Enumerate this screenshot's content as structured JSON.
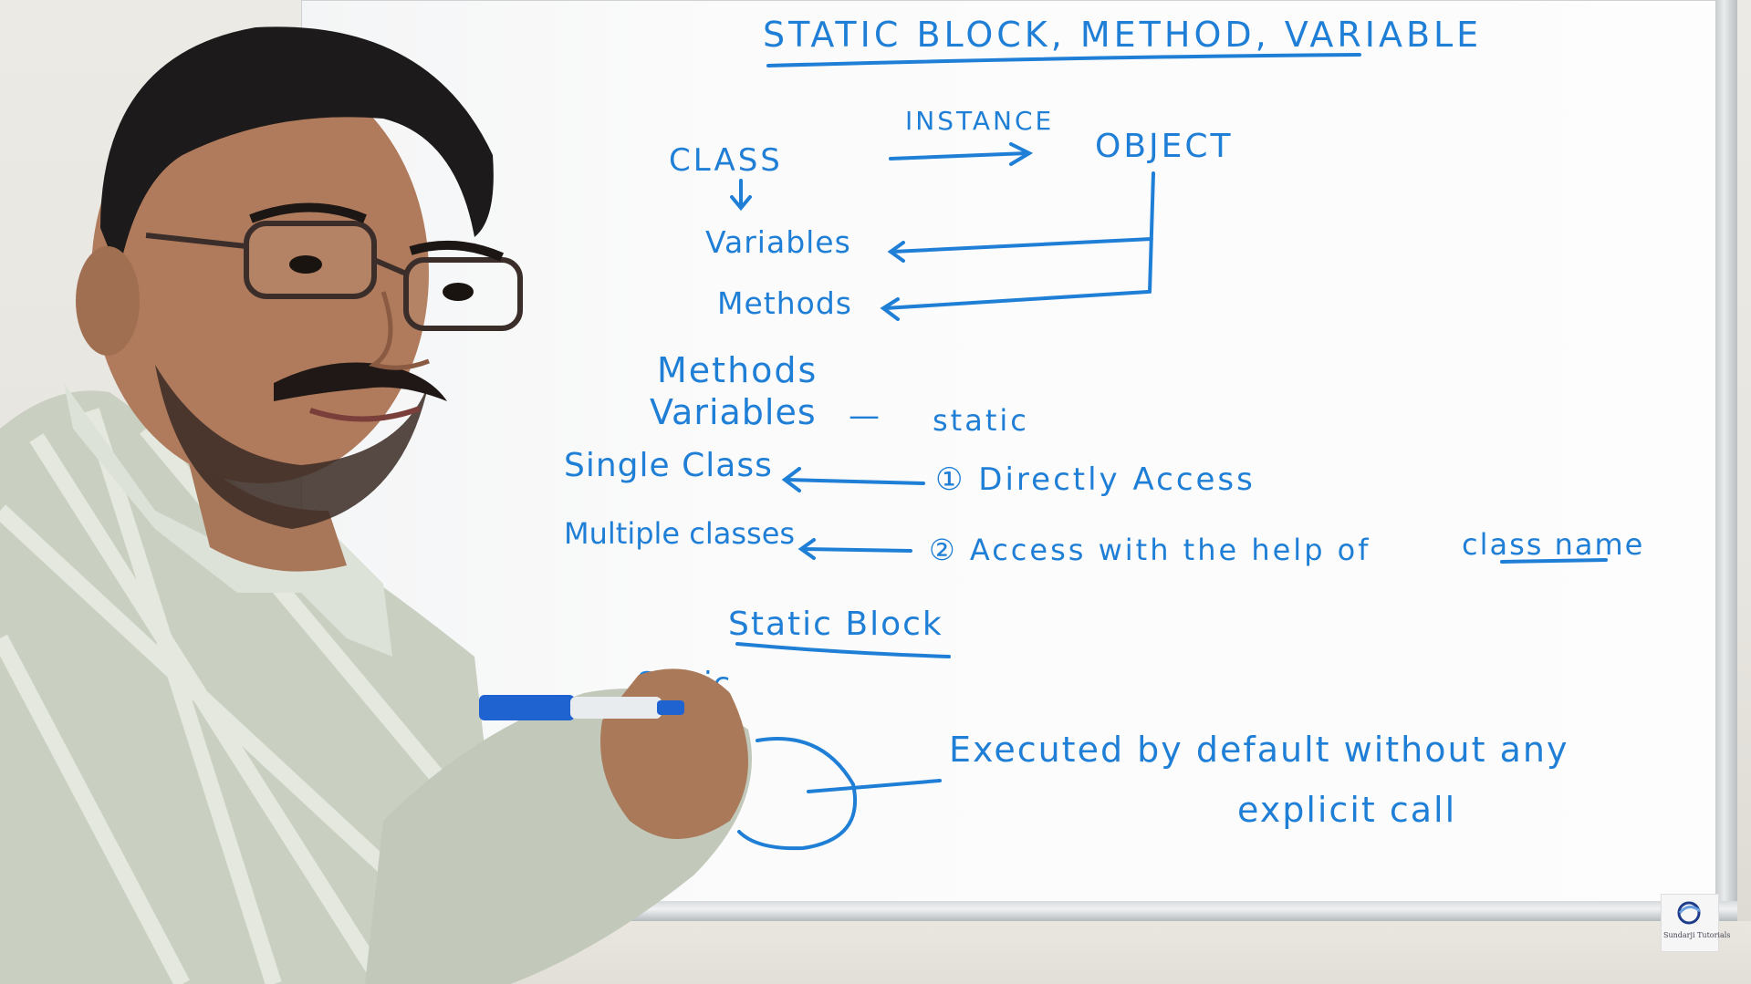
{
  "board": {
    "title": "STATIC BLOCK, METHOD, VARIABLE",
    "class_label": "CLASS",
    "instance_label": "INSTANCE",
    "object_label": "OBJECT",
    "variables_1": "Variables",
    "methods_1": "Methods",
    "methods_2": "Methods",
    "variables_2": "Variables",
    "static_dash": "—",
    "static_label": "static",
    "single_class": "Single Class",
    "directly_access": "① Directly Access",
    "multiple_classes": "Multiple classes",
    "access_help": "② Access with the help of",
    "class_name": "class name",
    "static_block_heading": "Static Block",
    "static_keyword": "Static",
    "executed_line1": "Executed by default without any",
    "executed_line2": "explicit call"
  },
  "logo": {
    "text": "Sundarji Tutorials"
  }
}
